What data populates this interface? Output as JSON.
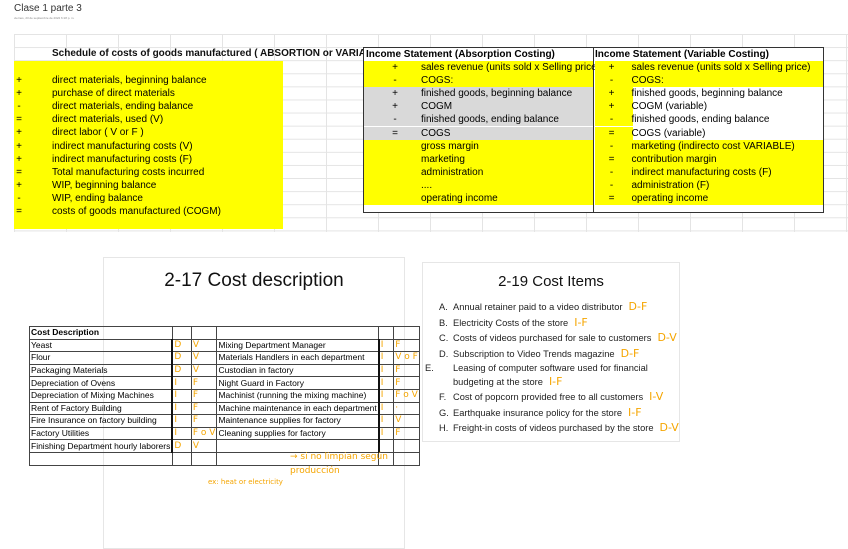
{
  "page": {
    "title": "Clase 1 parte 3",
    "date": "viernes, 23 de septiembre de 2022     6:18 p. m."
  },
  "schedule": {
    "title": "Schedule of costs of goods manufactured ( ABSORTION or VARIABLE )",
    "rows": [
      [
        "+",
        "direct materials, beginning balance"
      ],
      [
        "+",
        "purchase of direct materials"
      ],
      [
        "-",
        "direct materials, ending balance"
      ],
      [
        "=",
        "direct materials, used (V)"
      ],
      [
        "+",
        "direct labor ( V or F )"
      ],
      [
        "+",
        "indirect manufacturing costs (V)"
      ],
      [
        "+",
        "indirect manufacturing costs (F)"
      ],
      [
        "=",
        "Total manufacturing costs incurred"
      ],
      [
        "+",
        "WIP, beginning balance"
      ],
      [
        "-",
        "WIP, ending balance"
      ],
      [
        "=",
        "costs of goods manufactured (COGM)"
      ]
    ]
  },
  "absorption": {
    "title": "Income Statement (Absorption Costing)",
    "rows": [
      [
        "+",
        "sales revenue (units sold x Selling price)",
        "y"
      ],
      [
        "-",
        "COGS:",
        "y"
      ],
      [
        "+",
        "finished goods, beginning balance",
        "g"
      ],
      [
        "+",
        "COGM",
        "g"
      ],
      [
        "-",
        "finished goods, ending balance",
        "g"
      ],
      [
        "=",
        "COGS",
        "g"
      ],
      [
        "",
        "gross margin",
        "y"
      ],
      [
        "",
        "marketing",
        "y"
      ],
      [
        "",
        "administration",
        "y"
      ],
      [
        "",
        "....",
        "y"
      ],
      [
        "",
        "operating income",
        "y"
      ]
    ]
  },
  "variable": {
    "title": "Income Statement (Variable Costing)",
    "rows": [
      [
        "+",
        "sales revenue (units sold x Selling price)",
        "y"
      ],
      [
        "-",
        "COGS:",
        "y"
      ],
      [
        "+",
        "finished goods, beginning balance",
        "w"
      ],
      [
        "+",
        "COGM (variable)",
        "w"
      ],
      [
        "-",
        "finished goods, ending balance",
        "w"
      ],
      [
        "=",
        "COGS (variable)",
        "w"
      ],
      [
        "-",
        "marketing (indirecto cost VARIABLE)",
        "y"
      ],
      [
        "=",
        "contribution margin",
        "y"
      ],
      [
        "-",
        "indirect manufacturing costs (F)",
        "y"
      ],
      [
        "-",
        "administration (F)",
        "y"
      ],
      [
        "=",
        "operating income",
        "y"
      ]
    ]
  },
  "slide17": {
    "title": "2-17 Cost description",
    "header": "Cost Description",
    "rows": [
      [
        "Yeast",
        "D",
        "V",
        "Mixing Department Manager",
        "I",
        "F"
      ],
      [
        "Flour",
        "D",
        "V",
        "Materials Handlers in each department",
        "I",
        "V o F"
      ],
      [
        "Packaging Materials",
        "D",
        "V",
        "Custodian in  factory",
        "I",
        "F"
      ],
      [
        "Depreciation of Ovens",
        "I",
        "F",
        "Night Guard in Factory",
        "I",
        "F"
      ],
      [
        "Depreciation of Mixing Machines",
        "I",
        "F",
        "Machinist (running the mixing machine)",
        "I",
        "F o V"
      ],
      [
        "Rent of Factory Building",
        "I",
        "F",
        "Machine maintenance in each department",
        "I",
        "·"
      ],
      [
        "Fire Insurance on factory building",
        "I",
        "F",
        "Maintenance supplies for factory",
        "I",
        "V"
      ],
      [
        "Factory Utilities",
        "I",
        "F o V",
        "Cleaning supplies for factory",
        "I",
        "F"
      ],
      [
        "Finishing Department hourly laborers",
        "D",
        "V",
        "",
        "",
        ""
      ]
    ],
    "notes": {
      "utilities": "ex: heat or electricity",
      "cleaning": "→ si no limpian según producción"
    }
  },
  "slide19": {
    "title": "2-19 Cost Items",
    "items": [
      [
        "A.",
        "Annual retainer paid to a video distributor",
        "D-F"
      ],
      [
        "B.",
        "Electricity Costs of the store",
        "I-F"
      ],
      [
        "C.",
        "Costs of videos purchased for sale to customers",
        "D-V"
      ],
      [
        "D.",
        "Subscription to Video Trends magazine",
        "D-F"
      ],
      [
        "E.",
        "Leasing of computer software used for financial budgeting at the store",
        "I-F"
      ],
      [
        "F.",
        "Cost of popcorn provided free to all customers",
        "I-V"
      ],
      [
        "G.",
        "Earthquake insurance policy for the store",
        "I-F"
      ],
      [
        "H.",
        "Freight-in costs of videos purchased by the store",
        "D-V"
      ]
    ]
  },
  "colors": {
    "highlight": "#ffff00",
    "grey": "#d9d9d9",
    "ink": "#f5a500"
  }
}
